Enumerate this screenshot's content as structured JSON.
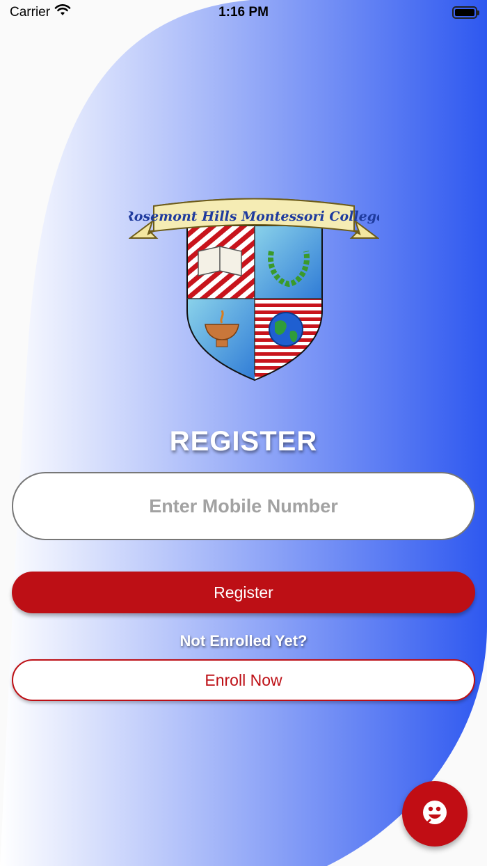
{
  "status_bar": {
    "carrier": "Carrier",
    "time": "1:16 PM"
  },
  "crest": {
    "banner_text": "Rosemont Hills Montessori College"
  },
  "form": {
    "title": "REGISTER",
    "mobile_placeholder": "Enter Mobile Number",
    "register_label": "Register",
    "not_enrolled_text": "Not Enrolled Yet?",
    "enroll_label": "Enroll Now"
  },
  "fab": {
    "icon": "support-face-icon"
  },
  "colors": {
    "gradient_start": "#ffffff",
    "gradient_end": "#2e58f0",
    "primary_red": "#bd0f15"
  }
}
